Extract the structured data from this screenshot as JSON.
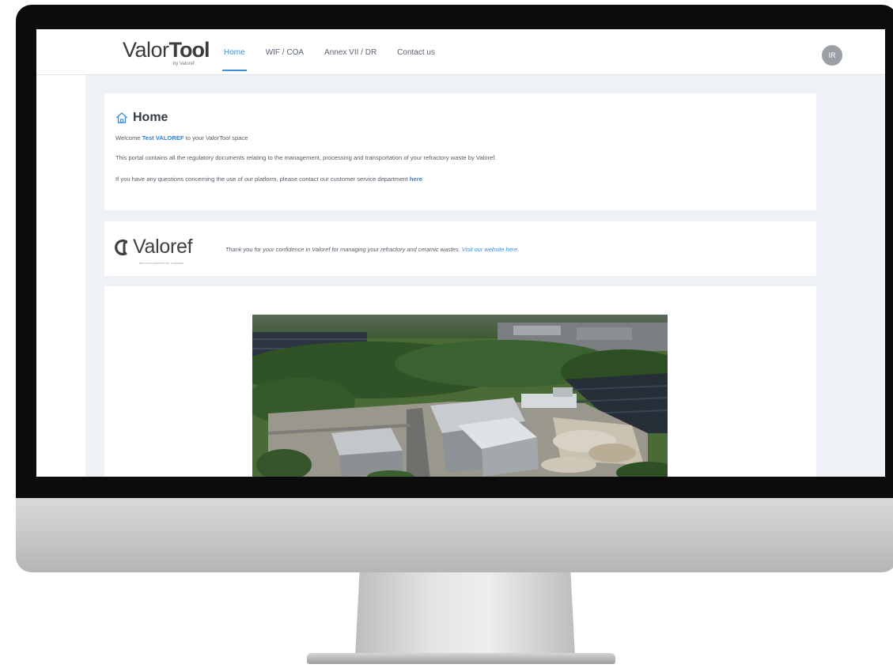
{
  "app": {
    "logo_text": "Valor",
    "logo_text_bold": "Tool",
    "logo_sub": "by Valoref"
  },
  "nav": {
    "items": [
      {
        "label": "Home",
        "active": true
      },
      {
        "label": "WIF / COA",
        "active": false
      },
      {
        "label": "Annex VII / DR",
        "active": false
      },
      {
        "label": "Contact us",
        "active": false
      }
    ]
  },
  "user": {
    "initials": "IR"
  },
  "home": {
    "title": "Home",
    "welcome_prefix": "Welcome",
    "user_name": "Test VALOREF",
    "welcome_suffix": "to your ValorTool space",
    "description": "This portal contains all the regulatory documents relating to the management, processing and transportation of your refractory waste by Valoref.",
    "contact_prefix": "If you have any questions concerning the use of our platform, please contact our customer service department",
    "contact_link": "here"
  },
  "valoref": {
    "brand": "Valoref",
    "tagline": "RECYCLING REFRACTORY & CERAMIC",
    "thanks_text": "Thank you for your confidence in Valoref for managing your refractory and ceramic wastes.",
    "website_link": "Visit our website here."
  },
  "colors": {
    "accent": "#3d8de0",
    "background": "#eef1f5",
    "avatar": "#9aa0a6"
  }
}
